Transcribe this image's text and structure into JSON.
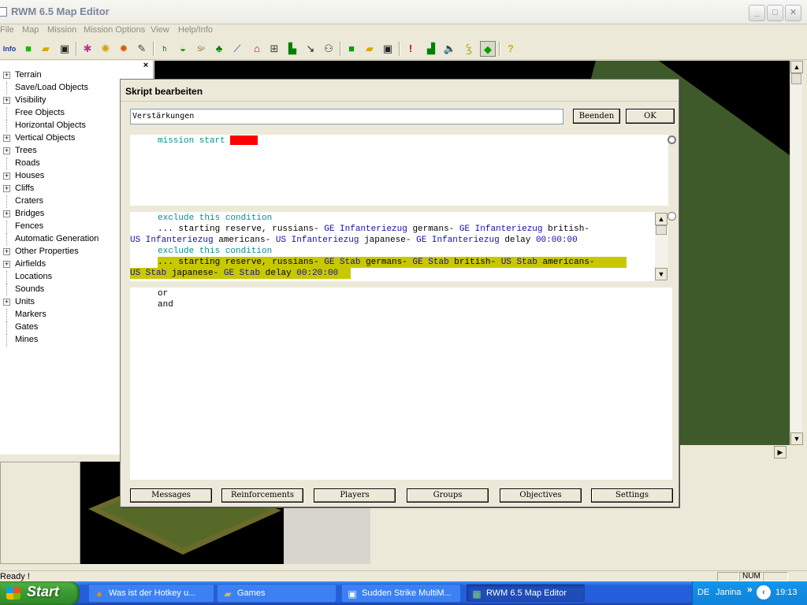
{
  "window": {
    "title": "RWM 6.5 Map Editor",
    "minimize": "_",
    "maximize": "□",
    "close": "✕"
  },
  "menu": [
    "File",
    "Map",
    "Mission",
    "Mission Options",
    "View",
    "Help/Info"
  ],
  "toolbar": {
    "info_label": "Info"
  },
  "tree": {
    "close_label": "×",
    "items": [
      {
        "label": "Terrain",
        "expand": "+"
      },
      {
        "label": "Save/Load Objects",
        "expand": ""
      },
      {
        "label": "Visibility",
        "expand": "+"
      },
      {
        "label": "Free Objects",
        "expand": ""
      },
      {
        "label": "Horizontal Objects",
        "expand": ""
      },
      {
        "label": "Vertical Objects",
        "expand": "+"
      },
      {
        "label": "Trees",
        "expand": "+"
      },
      {
        "label": "Roads",
        "expand": ""
      },
      {
        "label": "Houses",
        "expand": "+"
      },
      {
        "label": "Cliffs",
        "expand": "+"
      },
      {
        "label": "Craters",
        "expand": ""
      },
      {
        "label": "Bridges",
        "expand": "+"
      },
      {
        "label": "Fences",
        "expand": ""
      },
      {
        "label": "Automatic Generation",
        "expand": ""
      },
      {
        "label": "Other Properties",
        "expand": "+"
      },
      {
        "label": "Airfields",
        "expand": "+"
      },
      {
        "label": "Locations",
        "expand": ""
      },
      {
        "label": "Sounds",
        "expand": ""
      },
      {
        "label": "Units",
        "expand": "+"
      },
      {
        "label": "Markers",
        "expand": ""
      },
      {
        "label": "Gates",
        "expand": ""
      },
      {
        "label": "Mines",
        "expand": ""
      }
    ]
  },
  "dialog": {
    "title": "Skript bearbeiten",
    "script_name": "Verstärkungen",
    "buttons": {
      "end": "Beenden",
      "ok": "OK"
    },
    "trigger": {
      "keyword": "mission start"
    },
    "conditions": {
      "line1": "exclude this condition",
      "line2a": "... starting reserve, russians- ",
      "line2b": "GE Infanteriezug",
      "line2c": " germans- ",
      "line2d": "GE Infanteriezug",
      "line2e": " british-",
      "line3a": "US Infanteriezug",
      "line3b": " americans- ",
      "line3c": "US Infanteriezug",
      "line3d": " japanese- ",
      "line3e": "GE Infanteriezug",
      "line3f": " delay ",
      "line3g": "00:00:00",
      "line4": "exclude this condition",
      "line5a": "... starting reserve, russians- ",
      "line5b": "GE Stab",
      "line5c": " germans- ",
      "line5d": "GE Stab",
      "line5e": " british- ",
      "line5f": "US Stab",
      "line5g": " americans-",
      "line6a": "US Stab",
      "line6b": " japanese- ",
      "line6c": "GE Stab",
      "line6d": " delay ",
      "line6e": "00:20:00"
    },
    "logic": [
      "or",
      "and"
    ],
    "tabs": [
      "Messages",
      "Reinforcements",
      "Players",
      "Groups",
      "Objectives",
      "Settings"
    ]
  },
  "status": {
    "text": "Ready !",
    "num": "NUM"
  },
  "taskbar": {
    "start": "Start",
    "tasks": [
      {
        "label": "Was ist der Hotkey u...",
        "icon": "firefox-icon"
      },
      {
        "label": "Games",
        "icon": "folder-icon"
      },
      {
        "label": "Sudden Strike MultiM...",
        "icon": "app-icon"
      },
      {
        "label": "RWM 6.5 Map Editor",
        "icon": "map-editor-icon"
      }
    ],
    "tray": {
      "lang": "DE",
      "user": "Janina",
      "expand": "»",
      "time": "19:13"
    }
  }
}
